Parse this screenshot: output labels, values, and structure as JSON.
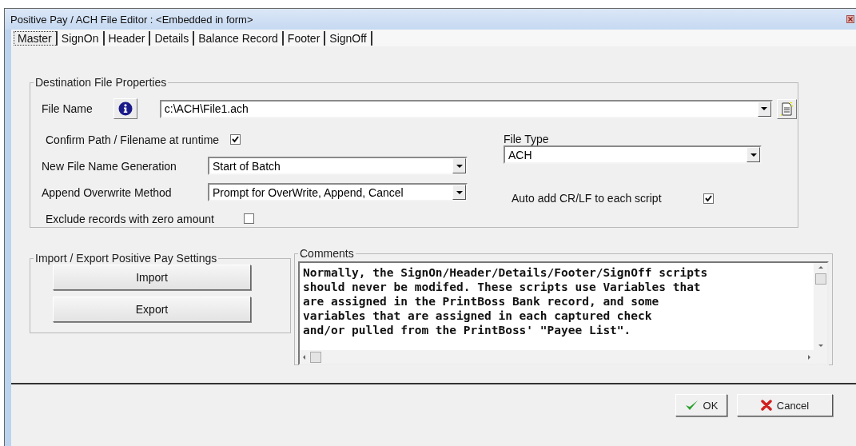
{
  "window": {
    "title": "Positive Pay / ACH File  Editor : <Embedded in form>"
  },
  "tabs": [
    {
      "label": "Master",
      "selected": true
    },
    {
      "label": "SignOn",
      "selected": false
    },
    {
      "label": "Header",
      "selected": false
    },
    {
      "label": "Details",
      "selected": false
    },
    {
      "label": "Balance Record",
      "selected": false
    },
    {
      "label": "Footer",
      "selected": false
    },
    {
      "label": "SignOff",
      "selected": false
    }
  ],
  "destination": {
    "title": "Destination File Properties",
    "file_name": {
      "label": "File Name",
      "value": "c:\\ACH\\File1.ach"
    },
    "confirm": {
      "label": "Confirm  Path / Filename at runtime",
      "checked": true
    },
    "new_file_name_generation": {
      "label": "New File Name Generation",
      "value": "Start of Batch"
    },
    "append_overwrite_method": {
      "label": "Append Overwrite Method",
      "value": "Prompt for OverWrite,  Append, Cancel"
    },
    "exclude_zero_amount": {
      "label": "Exclude records with zero amount",
      "checked": false
    },
    "file_type": {
      "label": "File Type",
      "value": "ACH"
    },
    "auto_crlf": {
      "label": "Auto add CR/LF to each script",
      "checked": true
    }
  },
  "import_export": {
    "title": "Import / Export Positive Pay Settings",
    "buttons": [
      "Import",
      "Export"
    ]
  },
  "comments": {
    "title": "Comments",
    "text": "Normally, the SignOn/Header/Details/Footer/SignOff scripts\nshould never be modifed. These scripts use Variables that\nare assigned in the PrintBoss Bank record, and some\nvariables that are assigned in each captured check\nand/or pulled from the PrintBoss' \"Payee List\"."
  },
  "buttons": [
    {
      "label": "OK",
      "kind": "ok"
    },
    {
      "label": "Cancel",
      "kind": "cancel"
    }
  ]
}
